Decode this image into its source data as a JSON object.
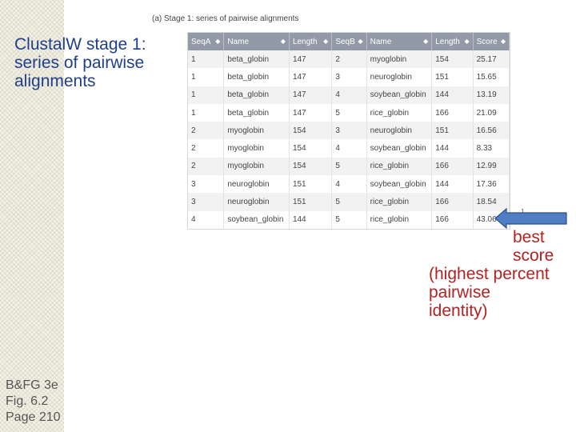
{
  "slide": {
    "title": "ClustalW stage 1: series of pairwise alignments",
    "source": [
      "B&FG 3e",
      "Fig. 6.2",
      "Page 210"
    ]
  },
  "figure": {
    "caption": "(a) Stage 1: series of pairwise alignments",
    "marker": "1",
    "columns": [
      {
        "label": "SeqA",
        "sort": "◆"
      },
      {
        "label": "Name",
        "sort": "◆"
      },
      {
        "label": "Length",
        "sort": "◆"
      },
      {
        "label": "SeqB",
        "sort": "◆"
      },
      {
        "label": "Name",
        "sort": "◆"
      },
      {
        "label": "Length",
        "sort": "◆"
      },
      {
        "label": "Score",
        "sort": "◆"
      }
    ],
    "rows": [
      [
        "1",
        "beta_globin",
        "147",
        "2",
        "myoglobin",
        "154",
        "25.17"
      ],
      [
        "1",
        "beta_globin",
        "147",
        "3",
        "neuroglobin",
        "151",
        "15.65"
      ],
      [
        "1",
        "beta_globin",
        "147",
        "4",
        "soybean_globin",
        "144",
        "13.19"
      ],
      [
        "1",
        "beta_globin",
        "147",
        "5",
        "rice_globin",
        "166",
        "21.09"
      ],
      [
        "2",
        "myoglobin",
        "154",
        "3",
        "neuroglobin",
        "151",
        "16.56"
      ],
      [
        "2",
        "myoglobin",
        "154",
        "4",
        "soybean_globin",
        "144",
        "8.33"
      ],
      [
        "2",
        "myoglobin",
        "154",
        "5",
        "rice_globin",
        "166",
        "12.99"
      ],
      [
        "3",
        "neuroglobin",
        "151",
        "4",
        "soybean_globin",
        "144",
        "17.36"
      ],
      [
        "3",
        "neuroglobin",
        "151",
        "5",
        "rice_globin",
        "166",
        "18.54"
      ],
      [
        "4",
        "soybean_globin",
        "144",
        "5",
        "rice_globin",
        "166",
        "43.06"
      ]
    ]
  },
  "annotation": {
    "lines": [
      "best",
      "score",
      "(highest percent",
      "pairwise",
      "identity)"
    ],
    "arrow_color": "#4f7ec4"
  }
}
